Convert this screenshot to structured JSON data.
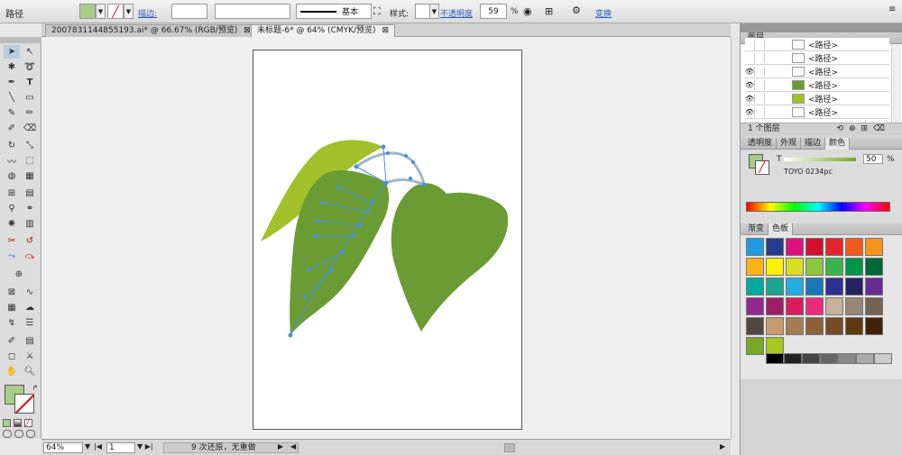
{
  "control_bar": {
    "object_type": "路径",
    "stroke_label": "描边:",
    "brush_label": "基本",
    "style_label": "样式:",
    "opacity_label": "不透明度",
    "opacity_value": "59",
    "percent": "%",
    "transform_label": "变换"
  },
  "tabs": [
    {
      "label": "20078311448551​93.ai* @ 66.67% (RGB/预览)"
    },
    {
      "label": "未标题-6* @ 64% (CMYK/预览)"
    }
  ],
  "status": {
    "zoom": "64%",
    "page": "1",
    "message": "9 次还原，无重做"
  },
  "layers_panel": {
    "title": "图层",
    "rows": [
      "<路径>",
      "<路径>",
      "<路径>",
      "<路径>",
      "<路径>",
      "<路径>"
    ],
    "footer": "1 个图层"
  },
  "color_panel": {
    "tabs": [
      "透明度",
      "外观",
      "描边",
      "颜色"
    ],
    "tint_label": "T",
    "tint_value": "50",
    "percent": "%",
    "swatch_name": "TOYO 0234pc"
  },
  "swatches_panel": {
    "tabs": [
      "渐变",
      "色板"
    ],
    "swatches": [
      "#1f9ae0",
      "#2a3a8c",
      "#e0117c",
      "#d40f2d",
      "#e3242b",
      "#ef5a1d",
      "#f7941d",
      "#fbb216",
      "#fff200",
      "#d7df23",
      "#8dc63f",
      "#39b54a",
      "#009444",
      "#006838",
      "#00a99d",
      "#1ba590",
      "#27aae1",
      "#1c75bc",
      "#2e3192",
      "#262262",
      "#662d91",
      "#92278f",
      "#9e1f63",
      "#da1c5c",
      "#ee2a7b",
      "#c7b299",
      "#998675",
      "#736357",
      "#534741",
      "#c69c6d",
      "#a67c52",
      "#8c6239",
      "#754c24",
      "#603913",
      "#42210b",
      "#7aa62a",
      "#a8c81e"
    ],
    "grays": [
      "#000000",
      "#222222",
      "#444444",
      "#666666",
      "#888888",
      "#aaaaaa",
      "#cccccc"
    ]
  },
  "colors": {
    "leaf_dark": "#6a9c33",
    "leaf_light": "#a3c12b",
    "path_selection": "#4a90e0",
    "fill_swatch": "#a9cc8a"
  }
}
